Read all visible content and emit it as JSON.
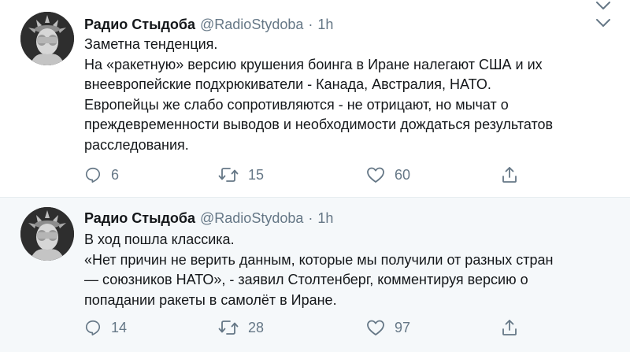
{
  "tweets": [
    {
      "author_name": "Радио Стыдоба",
      "handle": "@RadioStydoba",
      "separator": "·",
      "time": "1h",
      "lines": [
        "Заметна тенденция.",
        "На «ракетную» версию крушения боинга в Иране налегают США и их",
        "внеевропейские подхрюкиватели - Канада, Австралия, НАТО.",
        "Европейцы же слабо сопротивляются - не отрицают, но мычат о",
        "преждевременности выводов и необходимости дождаться результатов",
        "расследования."
      ],
      "replies": "6",
      "retweets": "15",
      "likes": "60"
    },
    {
      "author_name": "Радио Стыдоба",
      "handle": "@RadioStydoba",
      "separator": "·",
      "time": "1h",
      "lines": [
        "В ход пошла классика.",
        "«Нет причин не верить данным, которые мы получили от разных стран",
        "— союзников НАТО», - заявил Столтенберг, комментируя версию о",
        "попадании ракеты в самолёт в Иране."
      ],
      "replies": "14",
      "retweets": "28",
      "likes": "97"
    }
  ],
  "colors": {
    "text": "#14171a",
    "secondary": "#657786",
    "divider": "#e6ecf0",
    "highlight_bg": "#f5f8fa"
  },
  "icons": {
    "reply": "reply-icon",
    "retweet": "retweet-icon",
    "like": "like-icon",
    "share": "share-icon",
    "menu": "chevron-down-icon"
  }
}
